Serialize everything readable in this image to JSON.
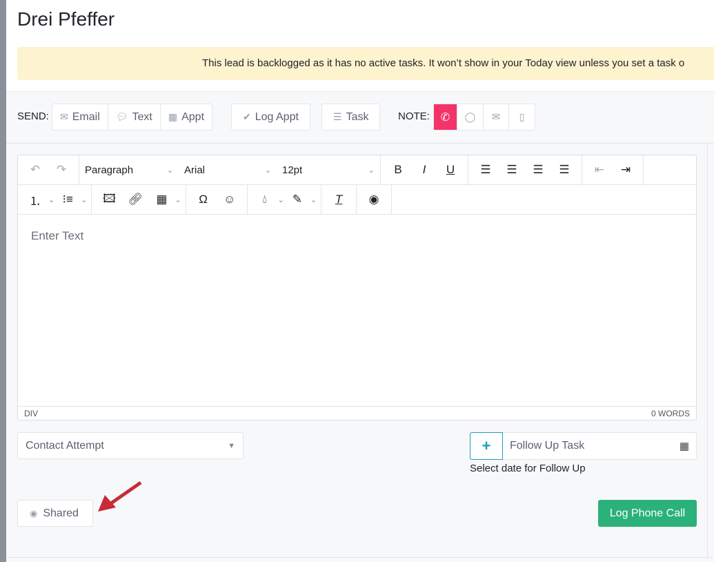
{
  "title": "Drei Pfeffer",
  "banner": "This lead is backlogged as it has no active tasks. It won’t show in your Today view unless you set a task o",
  "send": {
    "label": "SEND:",
    "email": "Email",
    "text": "Text",
    "appt": "Appt",
    "log_appt": "Log Appt",
    "task": "Task"
  },
  "note": {
    "label": "NOTE:",
    "active": "phone",
    "active_color": "#f5336b"
  },
  "editor": {
    "block": "Paragraph",
    "font": "Arial",
    "size": "12pt",
    "placeholder": "Enter Text",
    "path": "DIV",
    "words": "0 WORDS"
  },
  "contact_select": "Contact Attempt",
  "follow_up": {
    "placeholder": "Follow Up Task",
    "hint": "Select date for Follow Up"
  },
  "shared": "Shared",
  "submit": "Log Phone Call",
  "colors": {
    "primary": "#2bb179",
    "banner": "#fdf3cf",
    "follow_plus": "#1a9fb5"
  }
}
